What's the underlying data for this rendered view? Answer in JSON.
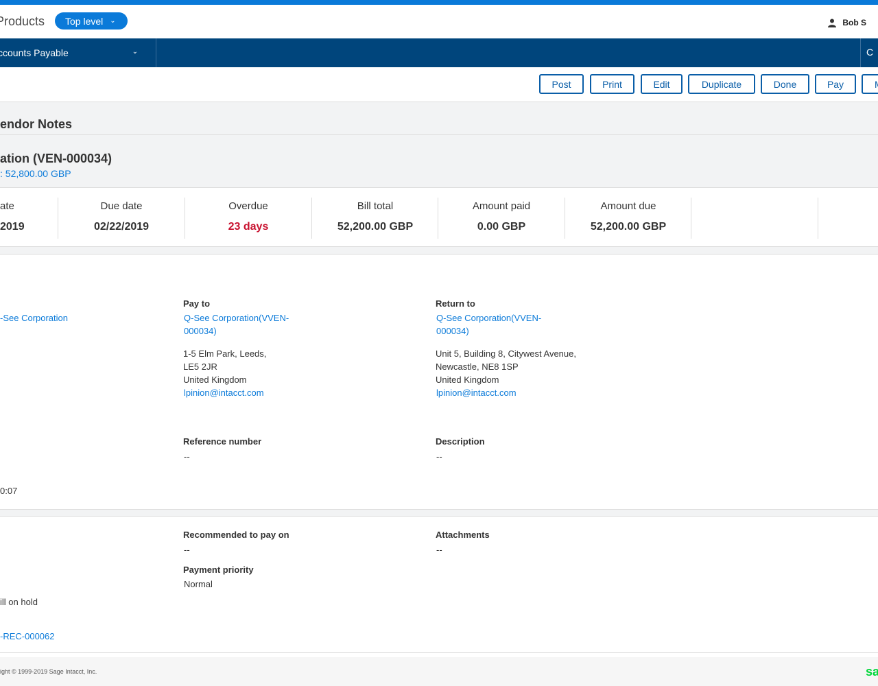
{
  "header": {
    "app_title": "Products",
    "level_label": "Top level",
    "user_name": "Bob S"
  },
  "nav": {
    "module_label": "ccounts Payable",
    "right_label": "C"
  },
  "toolbar": {
    "buttons": [
      "Post",
      "Print",
      "Edit",
      "Duplicate",
      "Done",
      "Pay",
      "M"
    ]
  },
  "section": {
    "title": "endor Notes"
  },
  "vendor": {
    "name": "ation (VEN-000034)",
    "balance_prefix": ":",
    "balance_amount": "52,800.00",
    "balance_currency": "GBP"
  },
  "summary": [
    {
      "label": "ate",
      "value": "2019"
    },
    {
      "label": "Due date",
      "value": "02/22/2019"
    },
    {
      "label": "Overdue",
      "value": "23 days"
    },
    {
      "label": "Bill total",
      "value": "52,200.00 GBP"
    },
    {
      "label": "Amount paid",
      "value": "0.00 GBP"
    },
    {
      "label": "Amount due",
      "value": "52,200.00 GBP"
    }
  ],
  "colors": {
    "accent": "#0a7ad9",
    "nav": "#00457c",
    "overdue": "#c8102e",
    "brand": "#00d639"
  },
  "details": {
    "vendor_link": "-See Corporation",
    "pay_to": {
      "label": "Pay to",
      "contact_line1": "Q-See Corporation(VVEN-",
      "contact_line2": "000034)",
      "address_line1": "1-5 Elm Park, Leeds,",
      "address_line2": "LE5 2JR",
      "country": "United Kingdom",
      "email": "lpinion@intacct.com"
    },
    "return_to": {
      "label": "Return to",
      "contact_line1": "Q-See Corporation(VVEN-",
      "contact_line2": "000034)",
      "address_line1": "Unit 5, Building 8, Citywest Avenue,",
      "address_line2": "Newcastle, NE8 1SP",
      "country": "United Kingdom",
      "email": "lpinion@intacct.com"
    },
    "reference_number": {
      "label": "Reference number",
      "value": "--"
    },
    "description": {
      "label": "Description",
      "value": "--"
    },
    "time_fragment": "0:07"
  },
  "details2": {
    "recommended": {
      "label": "Recommended to pay on",
      "value": "--"
    },
    "attachments": {
      "label": "Attachments",
      "value": "--"
    },
    "priority": {
      "label": "Payment priority",
      "value": "Normal"
    },
    "hold_fragment": "ill on hold",
    "rec_link": "-REC-000062"
  },
  "footer": {
    "copyright": "ight © 1999-2019 Sage Intacct, Inc.",
    "brand": "sa"
  }
}
